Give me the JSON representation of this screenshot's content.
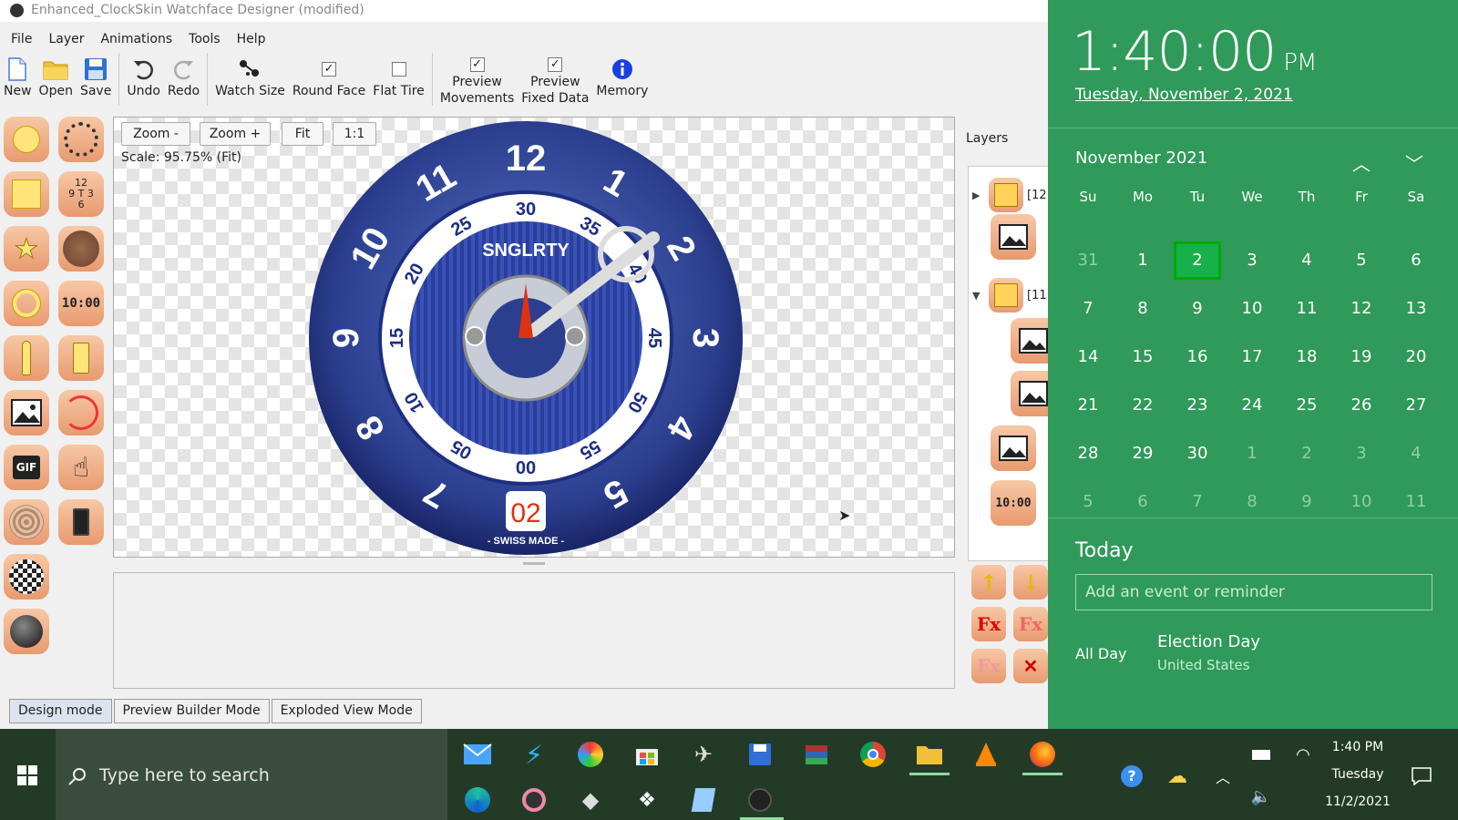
{
  "window": {
    "title": "Enhanced_ClockSkin Watchface Designer (modified)"
  },
  "menu": [
    "File",
    "Layer",
    "Animations",
    "Tools",
    "Help"
  ],
  "toolbar": {
    "new": "New",
    "open": "Open",
    "save": "Save",
    "undo": "Undo",
    "redo": "Redo",
    "watch_size": "Watch Size",
    "round_face": "Round Face",
    "flat_tire": "Flat Tire",
    "preview_movements_1": "Preview",
    "preview_movements_2": "Movements",
    "preview_fixed_1": "Preview",
    "preview_fixed_2": "Fixed Data",
    "memory": "Memory"
  },
  "zoom": {
    "zoom_out": "Zoom -",
    "zoom_in": "Zoom +",
    "fit": "Fit",
    "one_to_one": "1:1",
    "scale": "Scale:  95.75%  (Fit)"
  },
  "watch": {
    "brand": "SNGLRTY",
    "date": "02",
    "swiss": "- SWISS MADE -",
    "hours": [
      "12",
      "1",
      "2",
      "3",
      "4",
      "5",
      "6",
      "7",
      "8",
      "9",
      "10",
      "11"
    ],
    "minutes": [
      "30",
      "35",
      "40",
      "45",
      "50",
      "55",
      "00",
      "05",
      "10",
      "15",
      "20",
      "25"
    ]
  },
  "palette": {
    "clock_digits": "12\n9 T 3\n6",
    "digital": "10:00"
  },
  "layers": {
    "label": "Layers",
    "row1": "[12",
    "row3": "[11",
    "digital": "10:00"
  },
  "layer_buttons": {
    "fx": "Fx"
  },
  "modes": [
    "Design mode",
    "Preview Builder Mode",
    "Exploded View Mode"
  ],
  "calendar": {
    "time": "1:40:00",
    "ampm": "PM",
    "date": "Tuesday, November 2, 2021",
    "month": "November 2021",
    "weekdays": [
      "Su",
      "Mo",
      "Tu",
      "We",
      "Th",
      "Fr",
      "Sa"
    ],
    "weeks": [
      [
        "31",
        "1",
        "2",
        "3",
        "4",
        "5",
        "6"
      ],
      [
        "7",
        "8",
        "9",
        "10",
        "11",
        "12",
        "13"
      ],
      [
        "14",
        "15",
        "16",
        "17",
        "18",
        "19",
        "20"
      ],
      [
        "21",
        "22",
        "23",
        "24",
        "25",
        "26",
        "27"
      ],
      [
        "28",
        "29",
        "30",
        "1",
        "2",
        "3",
        "4"
      ],
      [
        "5",
        "6",
        "7",
        "8",
        "9",
        "10",
        "11"
      ]
    ],
    "today_label": "Today",
    "event_placeholder": "Add an event or reminder",
    "event_time": "All Day",
    "event_name": "Election Day",
    "event_location": "United States"
  },
  "taskbar": {
    "search_placeholder": "Type here to search",
    "clock_time": "1:40 PM",
    "clock_day": "Tuesday",
    "clock_date": "11/2/2021"
  },
  "colors": {
    "calendar_bg": "#2f9a5a",
    "today_highlight": "#18b04b",
    "watch_blue": "#2c3f8f",
    "taskbar": "#233b26"
  }
}
